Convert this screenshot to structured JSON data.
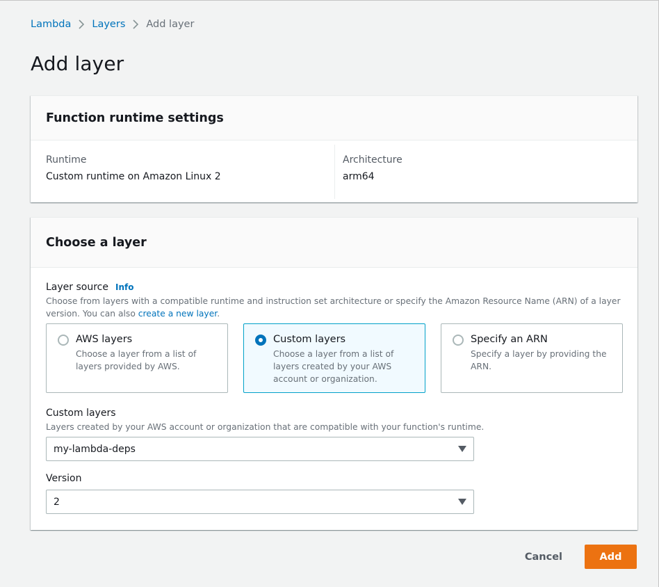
{
  "breadcrumb": {
    "items": [
      {
        "label": "Lambda"
      },
      {
        "label": "Layers"
      },
      {
        "label": "Add layer"
      }
    ]
  },
  "page": {
    "title": "Add layer"
  },
  "runtime_panel": {
    "title": "Function runtime settings",
    "runtime_label": "Runtime",
    "runtime_value": "Custom runtime on Amazon Linux 2",
    "architecture_label": "Architecture",
    "architecture_value": "arm64"
  },
  "layer_panel": {
    "title": "Choose a layer",
    "source_label": "Layer source",
    "info_label": "Info",
    "source_desc_prefix": "Choose from layers with a compatible runtime and instruction set architecture or specify the Amazon Resource Name (ARN) of a layer version. You can also ",
    "source_desc_link": "create a new layer",
    "source_desc_suffix": ".",
    "options": [
      {
        "title": "AWS layers",
        "desc": "Choose a layer from a list of layers provided by AWS.",
        "selected": false
      },
      {
        "title": "Custom layers",
        "desc": "Choose a layer from a list of layers created by your AWS account or organization.",
        "selected": true
      },
      {
        "title": "Specify an ARN",
        "desc": "Specify a layer by providing the ARN.",
        "selected": false
      }
    ],
    "custom_layers": {
      "label": "Custom layers",
      "desc": "Layers created by your AWS account or organization that are compatible with your function's runtime.",
      "value": "my-lambda-deps"
    },
    "version": {
      "label": "Version",
      "value": "2"
    }
  },
  "footer": {
    "cancel_label": "Cancel",
    "add_label": "Add"
  },
  "colors": {
    "link": "#0073bb",
    "primary_button": "#ec7211",
    "selected_tile_bg": "#f1faff",
    "selected_tile_border": "#00a1c9",
    "page_bg": "#f2f3f3"
  }
}
